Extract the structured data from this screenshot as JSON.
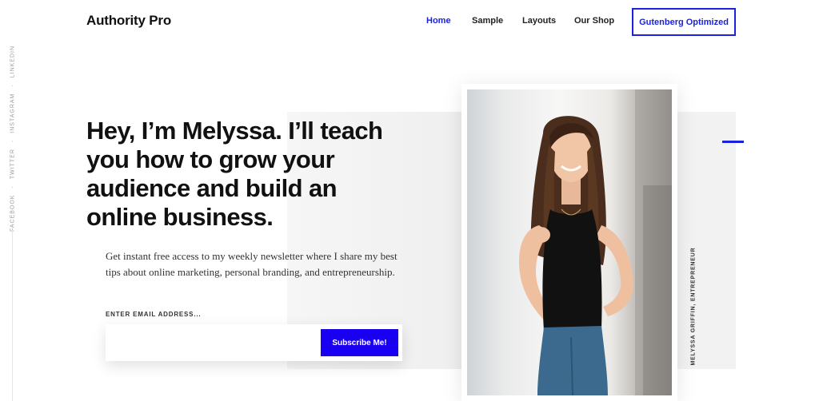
{
  "header": {
    "logo": "Authority Pro",
    "nav": [
      {
        "label": "Home",
        "active": true
      },
      {
        "label": "Sample",
        "active": false
      },
      {
        "label": "Layouts",
        "active": false
      },
      {
        "label": "Our Shop",
        "active": false
      }
    ],
    "cta_label": "Gutenberg Optimized"
  },
  "social": [
    "FACEBOOK",
    "TWITTER",
    "INSTAGRAM",
    "LINKEDIN"
  ],
  "hero": {
    "headline": "Hey, I’m Melyssa. I’ll teach you how to grow your audience and build an online business.",
    "intro": "Get instant free access to my weekly newsletter where I share my best tips about online marketing, personal branding, and entrepreneurship.",
    "email_label": "ENTER EMAIL ADDRESS...",
    "email_value": "",
    "subscribe_label": "Subscribe Me!"
  },
  "photo": {
    "caption": "MELYSSA GRIFFIN, ENTREPRENEUR"
  },
  "colors": {
    "accent": "#1a22e0",
    "panel": "#f2f2f2"
  }
}
